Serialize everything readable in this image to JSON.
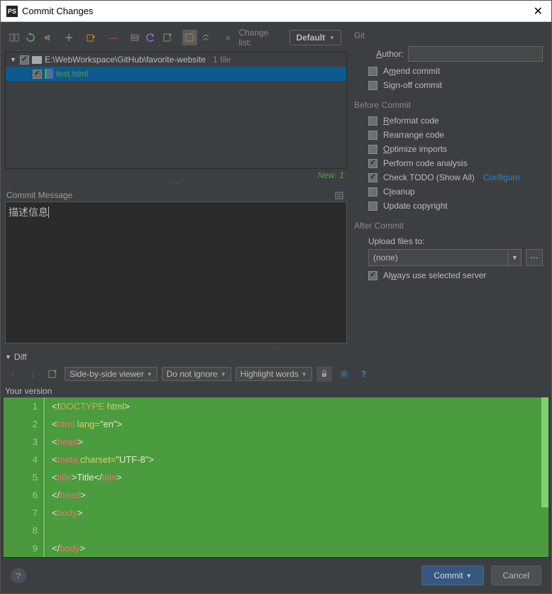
{
  "window": {
    "title": "Commit Changes"
  },
  "toolbar": {
    "changelist_label": "Change list:",
    "changelist_value": "Default"
  },
  "tree": {
    "root_path": "E:\\WebWorkspace\\GitHub\\favorite-website",
    "root_count": "1 file",
    "files": [
      {
        "name": "test.html"
      }
    ],
    "new_count": "New: 1"
  },
  "commit_message": {
    "header": "Commit Message",
    "text": "描述信息"
  },
  "git": {
    "section": "Git",
    "author_label": "Author:",
    "author_value": "",
    "amend": "Amend commit",
    "signoff": "Sign-off commit"
  },
  "before": {
    "section": "Before Commit",
    "reformat": "Reformat code",
    "rearrange": "Rearrange code",
    "optimize": "Optimize imports",
    "analysis": "Perform code analysis",
    "todo": "Check TODO (Show All)",
    "configure": "Configure",
    "cleanup": "Cleanup",
    "copyright": "Update copyright"
  },
  "after": {
    "section": "After Commit",
    "upload_label": "Upload files to:",
    "upload_value": "(none)",
    "always": "Always use selected server"
  },
  "diff": {
    "header": "Diff",
    "viewer": "Side-by-side viewer",
    "ignore": "Do not ignore",
    "highlight": "Highlight words",
    "your_version": "Your version"
  },
  "code_lines": [
    "<!DOCTYPE html>",
    "<html lang=\"en\">",
    "<head>",
    "    <meta charset=\"UTF-8\">",
    "    <title>Title</title>",
    "</head>",
    "<body>",
    "",
    "</body>"
  ],
  "footer": {
    "commit": "Commit",
    "cancel": "Cancel"
  }
}
